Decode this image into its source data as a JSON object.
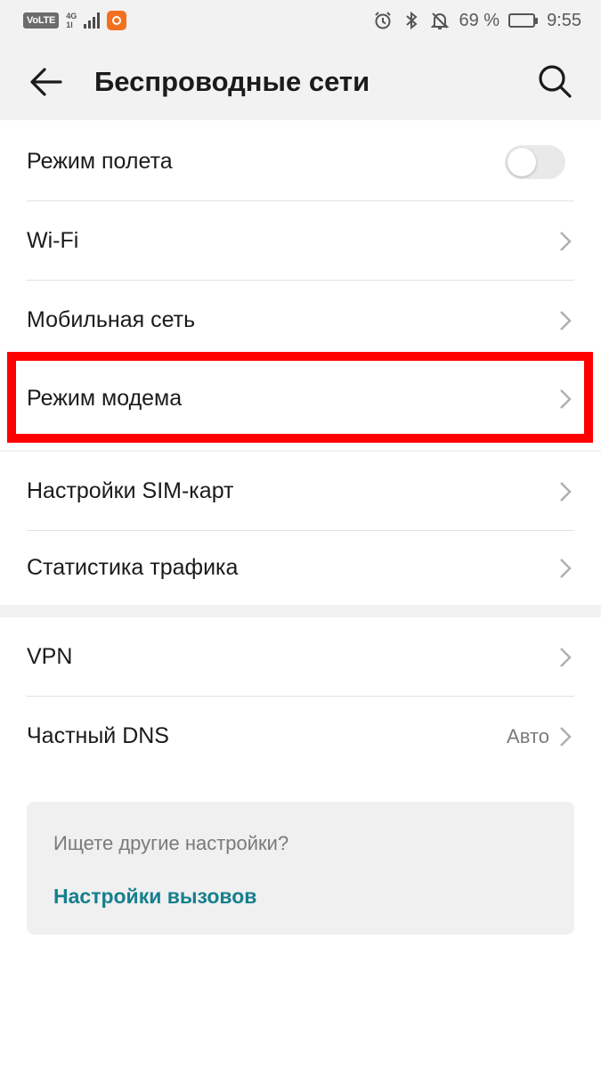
{
  "status_bar": {
    "volte": "VoLTE",
    "network_type": "4G",
    "network_sub": "1l",
    "battery_percent_text": "69 %",
    "battery_level": 0.69,
    "time": "9:55",
    "icons": [
      "alarm-icon",
      "bluetooth-icon",
      "notifications-off-icon"
    ]
  },
  "app_bar": {
    "title": "Беспроводные сети",
    "back_icon": "back-arrow-icon",
    "search_icon": "search-icon"
  },
  "groups": [
    {
      "items": [
        {
          "id": "airplane",
          "label": "Режим полета",
          "control": "toggle",
          "toggle_on": false
        },
        {
          "id": "wifi",
          "label": "Wi-Fi",
          "control": "chevron"
        },
        {
          "id": "mobile",
          "label": "Мобильная сеть",
          "control": "chevron"
        },
        {
          "id": "tethering",
          "label": "Режим модема",
          "control": "chevron",
          "highlighted": true
        }
      ]
    },
    {
      "items": [
        {
          "id": "sim",
          "label": "Настройки SIM-карт",
          "control": "chevron"
        },
        {
          "id": "traffic",
          "label": "Статистика трафика",
          "control": "chevron"
        }
      ]
    },
    {
      "items": [
        {
          "id": "vpn",
          "label": "VPN",
          "control": "chevron"
        },
        {
          "id": "dns",
          "label": "Частный DNS",
          "value": "Авто",
          "control": "chevron"
        }
      ]
    }
  ],
  "hint_card": {
    "question": "Ищете другие настройки?",
    "link": "Настройки вызовов"
  },
  "colors": {
    "accent_link": "#167f8e",
    "highlight_frame": "#ff0000",
    "app_badge": "#f37021",
    "header_bg": "#f2f2f2"
  }
}
